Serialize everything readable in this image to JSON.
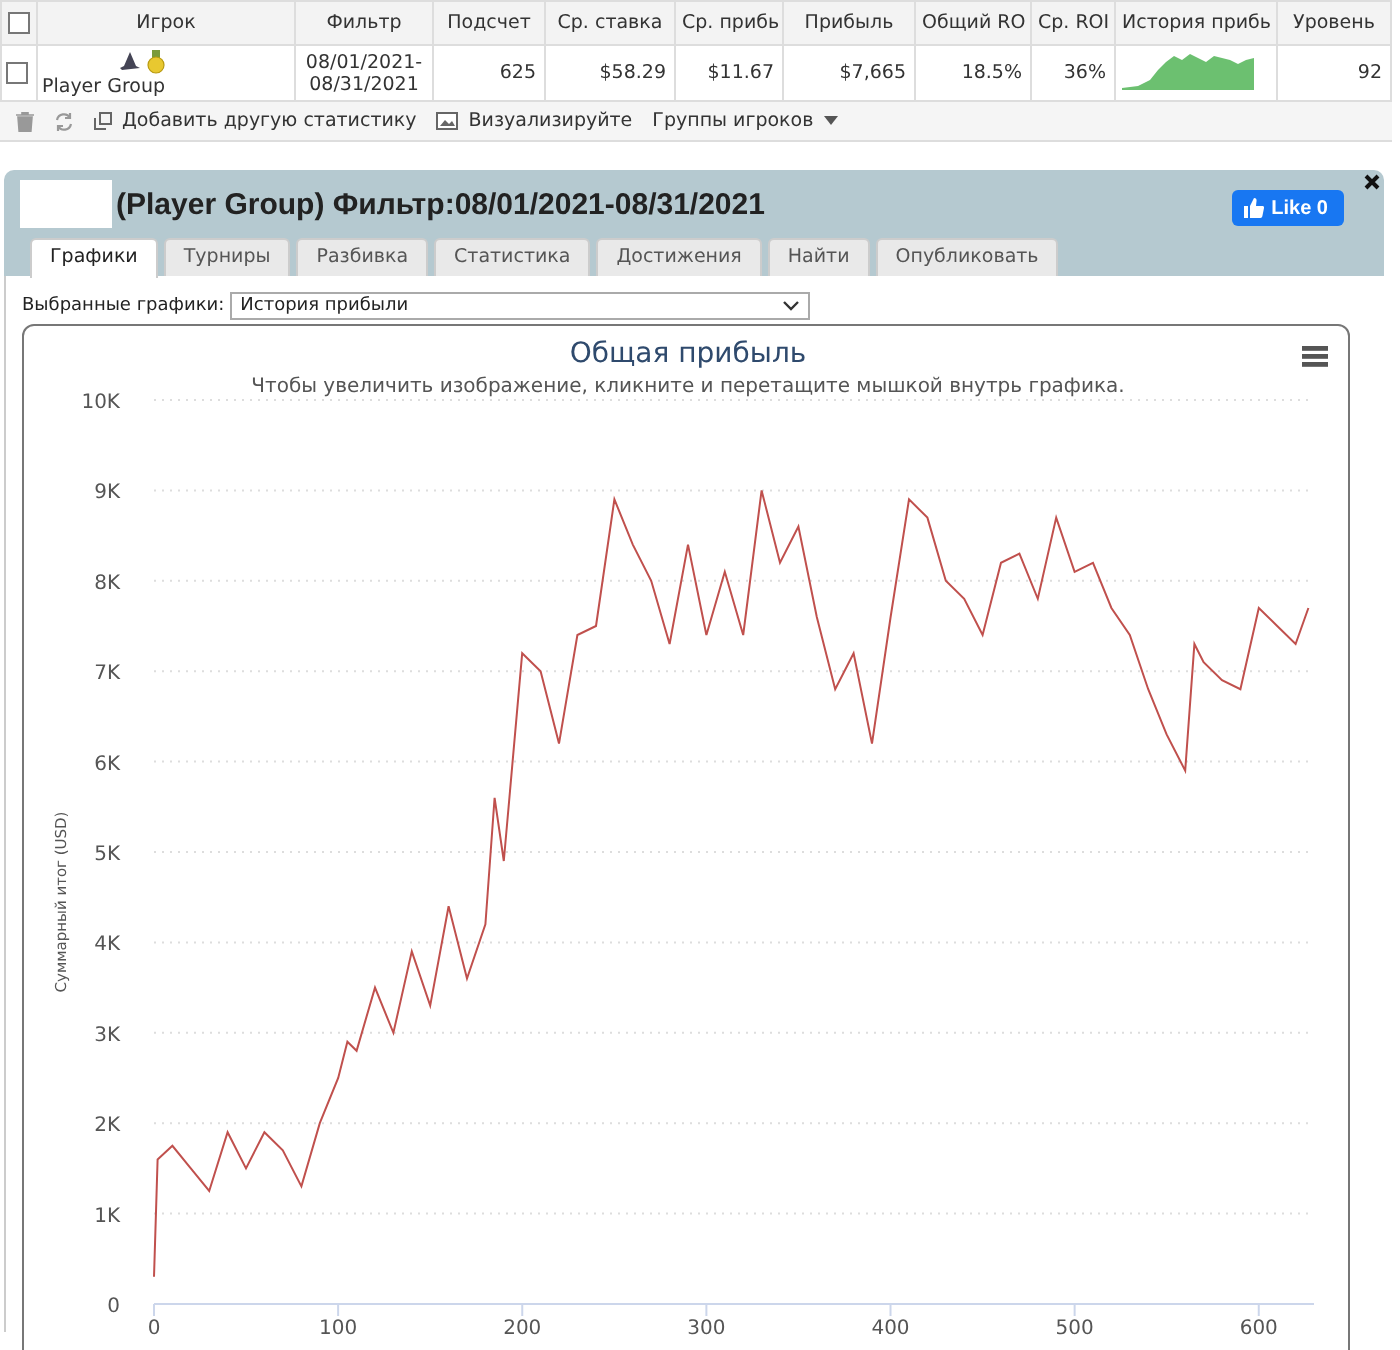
{
  "table": {
    "header_checked": false,
    "columns": [
      "Игрок",
      "Фильтр",
      "Подсчет",
      "Ср. ставка",
      "Ср. прибь",
      "Прибыль",
      "Общий RO",
      "Ср. ROI",
      "История прибь",
      "Уровень"
    ],
    "rows": [
      {
        "checked": false,
        "player": "Player Group",
        "filter_lines": [
          "08/01/2021-",
          "08/31/2021"
        ],
        "count": "625",
        "avg_stake": "$58.29",
        "avg_profit": "$11.67",
        "profit": "$7,665",
        "total_roi": "18.5%",
        "avg_roi": "36%",
        "level": "92"
      }
    ]
  },
  "toolbar": {
    "add_stats": "Добавить другую статистику",
    "visualize": "Визуализируйте",
    "groups": "Группы игроков"
  },
  "panel": {
    "title": "(Player Group) Фильтр:08/01/2021-08/31/2021",
    "like": "Like 0",
    "tabs": [
      {
        "label": "Графики",
        "selected": true
      },
      {
        "label": "Турниры",
        "selected": false
      },
      {
        "label": "Разбивка",
        "selected": false
      },
      {
        "label": "Статистика",
        "selected": false
      },
      {
        "label": "Достижения",
        "selected": false
      },
      {
        "label": "Найти",
        "selected": false
      },
      {
        "label": "Опубликовать",
        "selected": false
      }
    ],
    "select_label": "Выбранные графики:",
    "select_value": "История прибыли",
    "chart": {
      "subtitle": "Чтобы увеличить изображение, кликните и перетащите мышкой внутрь графика.",
      "chart_data": {
        "type": "line",
        "title": "Общая прибыль",
        "ylabel": "Суммарный итог (USD)",
        "x": [
          0,
          2,
          10,
          20,
          30,
          40,
          50,
          60,
          70,
          80,
          90,
          100,
          105,
          110,
          120,
          130,
          140,
          150,
          160,
          170,
          180,
          185,
          190,
          200,
          210,
          220,
          230,
          240,
          250,
          260,
          270,
          280,
          290,
          300,
          310,
          320,
          330,
          340,
          350,
          360,
          370,
          380,
          390,
          400,
          410,
          420,
          430,
          440,
          450,
          460,
          470,
          480,
          490,
          500,
          510,
          520,
          530,
          540,
          550,
          560,
          565,
          570,
          580,
          590,
          600,
          610,
          620,
          627
        ],
        "grid": true,
        "series": [
          {
            "color": "#c0504d",
            "values": [
              300,
              1600,
              1750,
              1500,
              1250,
              1900,
              1500,
              1900,
              1700,
              1300,
              2000,
              2500,
              2900,
              2800,
              3500,
              3000,
              3900,
              3300,
              4400,
              3600,
              4200,
              5600,
              4900,
              7200,
              7000,
              6200,
              7400,
              7500,
              8900,
              8400,
              8000,
              7300,
              8400,
              7400,
              8100,
              7400,
              9000,
              8200,
              8600,
              7600,
              6800,
              7200,
              6200,
              7600,
              8900,
              8700,
              8000,
              7800,
              7400,
              8200,
              8300,
              7800,
              8700,
              8100,
              8200,
              7700,
              7400,
              6800,
              6300,
              5900,
              7300,
              7100,
              6900,
              6800,
              7700,
              7500,
              7300,
              7700
            ]
          }
        ],
        "xlim": [
          0,
          630
        ],
        "ylim": [
          0,
          10000
        ],
        "xticks": [
          0,
          100,
          200,
          300,
          400,
          500,
          600
        ],
        "yticks": [
          {
            "value": 0,
            "label": "0"
          },
          {
            "value": 1000,
            "label": "1K"
          },
          {
            "value": 2000,
            "label": "2K"
          },
          {
            "value": 3000,
            "label": "3K"
          },
          {
            "value": 4000,
            "label": "4K"
          },
          {
            "value": 5000,
            "label": "5K"
          },
          {
            "value": 6000,
            "label": "6K"
          },
          {
            "value": 7000,
            "label": "7K"
          },
          {
            "value": 8000,
            "label": "8K"
          },
          {
            "value": 9000,
            "label": "9K"
          },
          {
            "value": 10000,
            "label": "10K"
          }
        ]
      }
    }
  }
}
